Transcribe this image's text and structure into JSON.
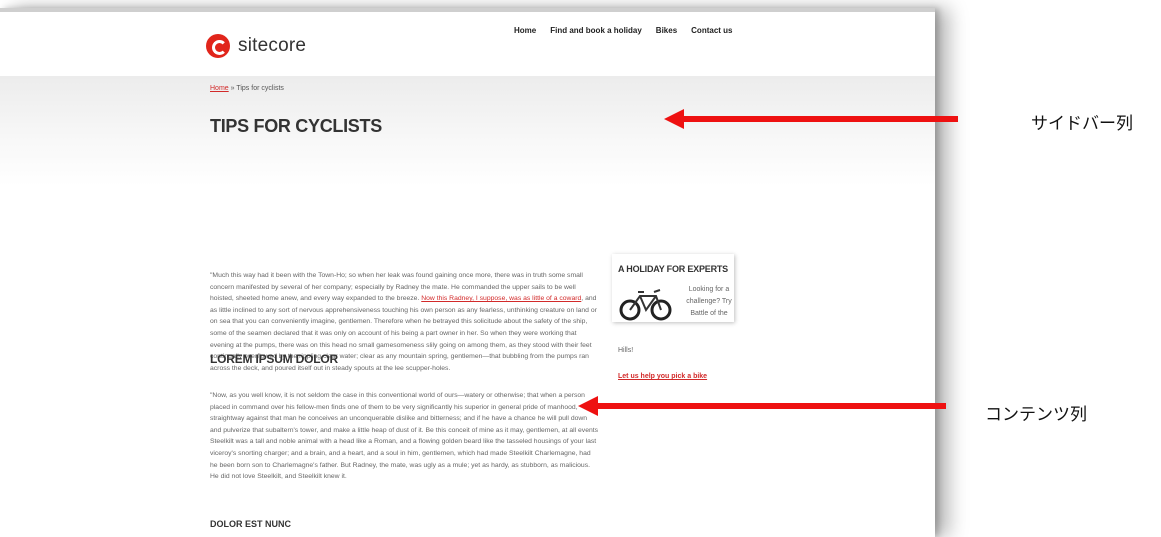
{
  "site": {
    "logo_text": "sitecore"
  },
  "nav": {
    "items": [
      "Home",
      "Find and book a holiday",
      "Bikes",
      "Contact us"
    ]
  },
  "breadcrumb": {
    "home": "Home",
    "separator": " » ",
    "current": "Tips for cyclists"
  },
  "page": {
    "title": "TIPS FOR CYCLISTS"
  },
  "content": {
    "paragraph1_start": "\"Much this way had it been with the Town-Ho; so when her leak was found gaining once more, there was in truth some small concern manifested by several of her company; especially by Radney the mate. He commanded the upper sails to be well hoisted, sheeted home anew, and every way expanded to the breeze. ",
    "paragraph1_link": "Now this Radney, I suppose, was as little of a coward",
    "paragraph1_end": ", and as little inclined to any sort of nervous apprehensiveness touching his own person as any fearless, unthinking creature on land or on sea that you can conveniently imagine, gentlemen. Therefore when he betrayed this solicitude about the safety of the ship, some of the seamen declared that it was only on account of his being a part owner in her. So when they were working that evening at the pumps, there was on this head no small gamesomeness slily going on among them, as they stood with their feet continually overflowed by the rippling clear water; clear as any mountain spring, gentlemen—that bubbling from the pumps ran across the deck, and poured itself out in steady spouts at the lee scupper-holes.",
    "section2_title": "LOREM IPSUM DOLOR",
    "paragraph2": "\"Now, as you well know, it is not seldom the case in this conventional world of ours—watery or otherwise; that when a person placed in command over his fellow-men finds one of them to be very significantly his superior in general pride of manhood, straightway against that man he conceives an unconquerable dislike and bitterness; and if he have a chance he will pull down and pulverize that subaltern's tower, and make a little heap of dust of it. Be this conceit of mine as it may, gentlemen, at all events Steelkilt was a tall and noble animal with a head like a Roman, and a flowing golden beard like the tasseled housings of your last viceroy's snorting charger; and a brain, and a heart, and a soul in him, gentlemen, which had made Steelkilt Charlemagne, had he been born son to Charlemagne's father. But Radney, the mate, was ugly as a mule; yet as hardy, as stubborn, as malicious. He did not love Steelkilt, and Steelkilt knew it.",
    "section3_title": "DOLOR EST NUNC"
  },
  "sidebar": {
    "widget_title": "A HOLIDAY FOR EXPERTS",
    "widget_text": "Looking for a challenge? Try Battle of the",
    "widget_text_tail": "Hills!",
    "widget_link": "Let us help you pick a bike",
    "bike_icon": "bicycle-icon"
  },
  "annotations": {
    "sidebar_label": "サイドバー列",
    "content_label": "コンテンツ列"
  },
  "colors": {
    "brand_red": "#e1251b",
    "link_red": "#d22a2a",
    "arrow_red": "#ee1111"
  }
}
